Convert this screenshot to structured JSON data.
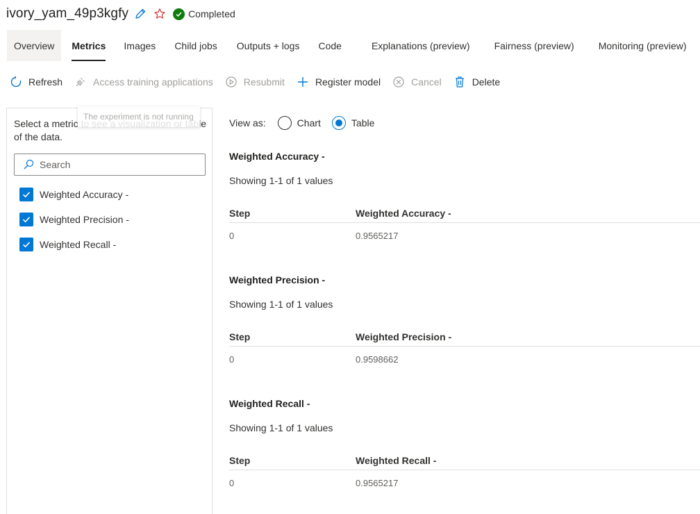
{
  "header": {
    "title": "ivory_yam_49p3kgfy",
    "status": "Completed"
  },
  "tabs": [
    {
      "label": "Overview"
    },
    {
      "label": "Metrics"
    },
    {
      "label": "Images"
    },
    {
      "label": "Child jobs"
    },
    {
      "label": "Outputs + logs"
    },
    {
      "label": "Code"
    },
    {
      "label": "Explanations (preview)"
    },
    {
      "label": "Fairness (preview)"
    },
    {
      "label": "Monitoring (preview)"
    }
  ],
  "toolbar": {
    "refresh": "Refresh",
    "access": "Access training applications",
    "resubmit": "Resubmit",
    "register": "Register model",
    "cancel": "Cancel",
    "delete": "Delete"
  },
  "tooltip": "The experiment is not running",
  "left_panel": {
    "description": "Select a metric to see a visualization or table of the data.",
    "search_placeholder": "Search",
    "metrics": [
      {
        "label": "Weighted Accuracy -",
        "checked": true
      },
      {
        "label": "Weighted Precision -",
        "checked": true
      },
      {
        "label": "Weighted Recall -",
        "checked": true
      }
    ]
  },
  "view_as": {
    "label": "View as:",
    "options": [
      "Chart",
      "Table"
    ],
    "selected": "Table"
  },
  "sections": [
    {
      "title": "Weighted Accuracy -",
      "count": "Showing 1-1 of 1 values",
      "col_step": "Step",
      "col_value": "Weighted Accuracy -",
      "rows": [
        {
          "step": "0",
          "value": "0.9565217"
        }
      ]
    },
    {
      "title": "Weighted Precision -",
      "count": "Showing 1-1 of 1 values",
      "col_step": "Step",
      "col_value": "Weighted Precision -",
      "rows": [
        {
          "step": "0",
          "value": "0.9598662"
        }
      ]
    },
    {
      "title": "Weighted Recall -",
      "count": "Showing 1-1 of 1 values",
      "col_step": "Step",
      "col_value": "Weighted Recall -",
      "rows": [
        {
          "step": "0",
          "value": "0.9565217"
        }
      ]
    }
  ],
  "colors": {
    "accent": "#0078d4",
    "success": "#107c10",
    "star": "#d13438"
  }
}
